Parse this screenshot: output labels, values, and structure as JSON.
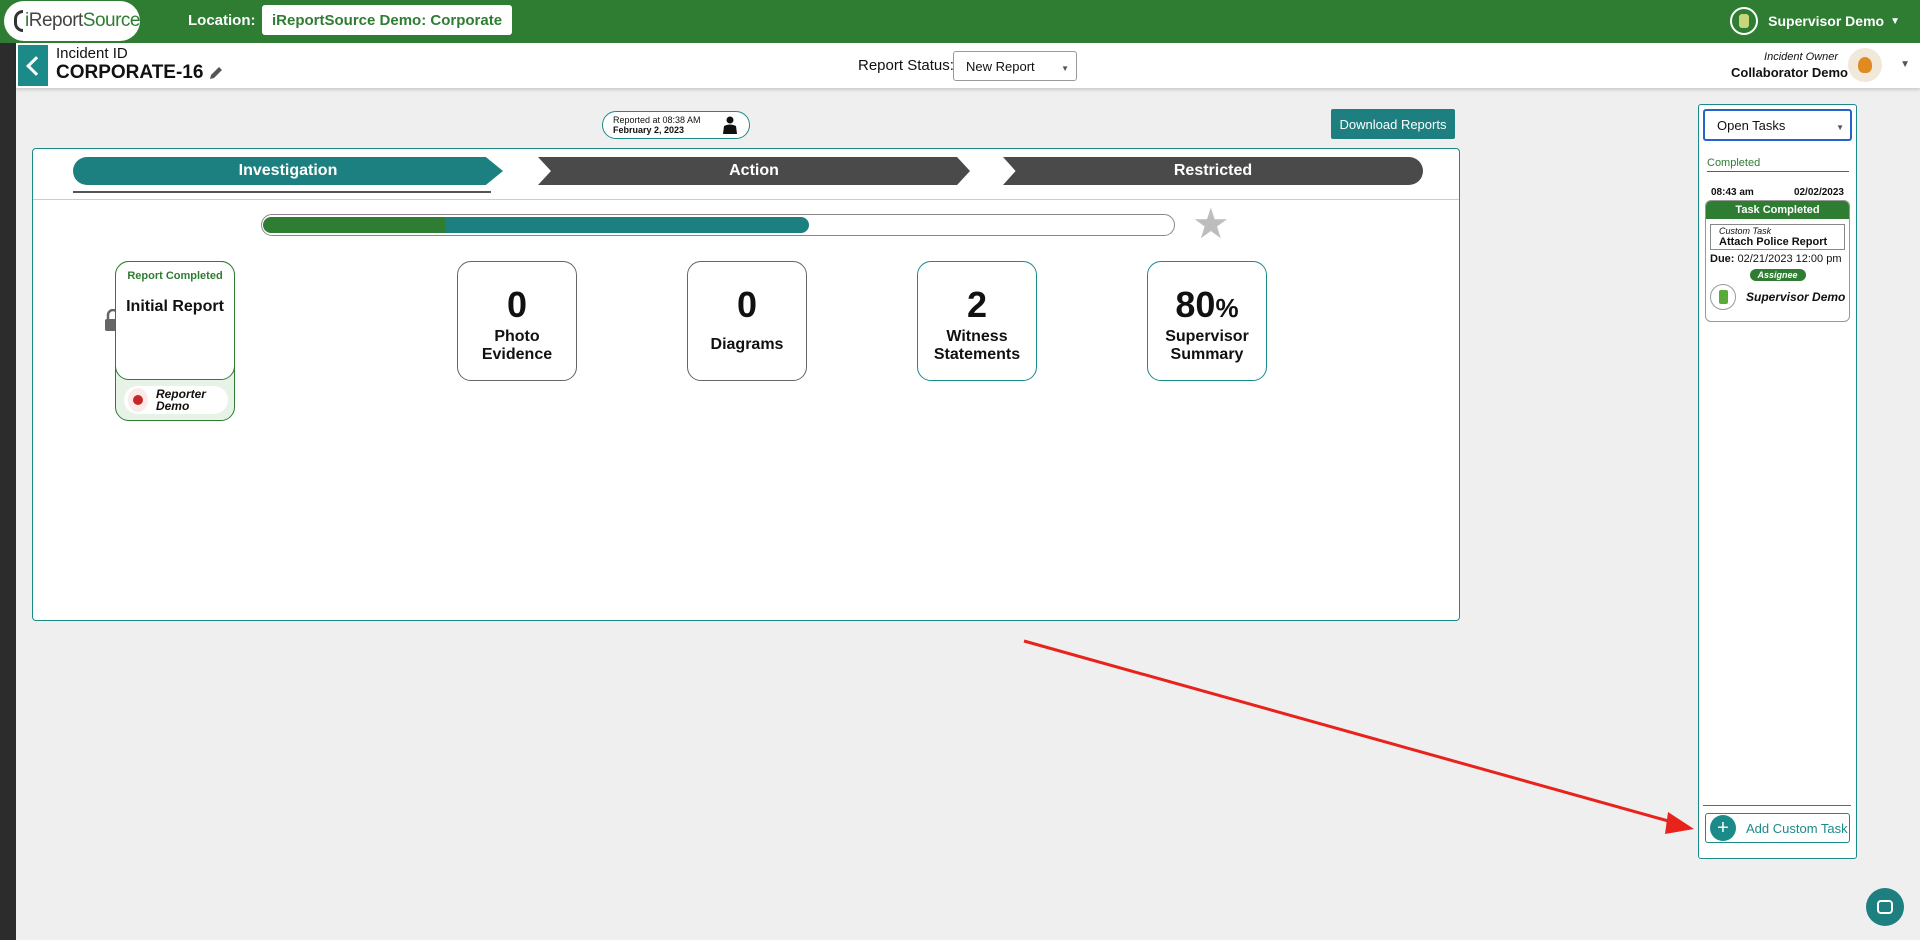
{
  "topbar": {
    "logo_text_a": "i",
    "logo_text_b": "Report",
    "logo_text_c": "Source",
    "location_label": "Location:",
    "location_value": "iReportSource Demo: Corporate",
    "user_name": "Supervisor Demo"
  },
  "header": {
    "incident_label": "Incident ID",
    "incident_id": "CORPORATE-16",
    "status_label": "Report Status:",
    "status_value": "New Report",
    "owner_label": "Incident Owner",
    "owner_name": "Collaborator Demo"
  },
  "reported": {
    "line1": "Reported at 08:38 AM",
    "line2": "February 2, 2023"
  },
  "download_label": "Download Reports",
  "steps": [
    {
      "label": "Investigation"
    },
    {
      "label": "Action"
    },
    {
      "label": "Restricted"
    }
  ],
  "progress": {
    "green_fraction": 0.2,
    "teal_fraction": 0.4
  },
  "initial_report": {
    "status": "Report Completed",
    "title": "Initial Report",
    "reporter": "Reporter Demo"
  },
  "cards": [
    {
      "num": "0",
      "label": "Photo Evidence"
    },
    {
      "num": "0",
      "label": "Diagrams"
    },
    {
      "num": "2",
      "label": "Witness Statements"
    },
    {
      "num": "80",
      "unit": "%",
      "label": "Supervisor Summary"
    }
  ],
  "tasks": {
    "filter": "Open Tasks",
    "section": "Completed",
    "time": "08:43 am",
    "date": "02/02/2023",
    "head": "Task Completed",
    "type": "Custom Task",
    "name": "Attach Police Report",
    "due_label": "Due:",
    "due_value": "02/21/2023 12:00 pm",
    "assignee_label": "Assignee",
    "assignee": "Supervisor Demo",
    "add_label": "Add Custom Task"
  },
  "colors": {
    "brand_green": "#2e7d32",
    "teal": "#1d7f7f",
    "annotation_red": "#e8231c"
  }
}
